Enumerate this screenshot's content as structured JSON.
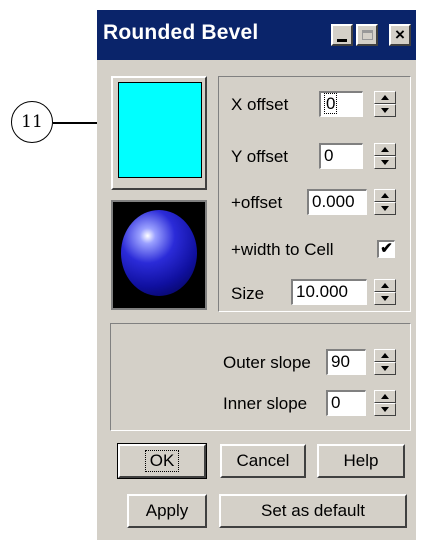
{
  "callout": {
    "number": "11"
  },
  "window": {
    "title": "Rounded Bevel",
    "title_buttons": {
      "close": "×"
    }
  },
  "colors": {
    "titlebar": "#0a246a",
    "swatch": "#00ffff",
    "face": "#d4d0c8"
  },
  "params": {
    "x_offset": {
      "label": "X offset",
      "value": "0"
    },
    "y_offset": {
      "label": "Y offset",
      "value": "0"
    },
    "plus_offset": {
      "label": "+offset",
      "value": "0.000"
    },
    "width_to_cell": {
      "label": "+width to Cell",
      "checked": "✔"
    },
    "size": {
      "label": "Size",
      "value": "10.000"
    }
  },
  "slopes": {
    "outer": {
      "label": "Outer slope",
      "value": "90"
    },
    "inner": {
      "label": "Inner slope",
      "value": "0"
    }
  },
  "buttons": {
    "ok": "OK",
    "cancel": "Cancel",
    "help": "Help",
    "apply": "Apply",
    "set_default": "Set as default"
  }
}
